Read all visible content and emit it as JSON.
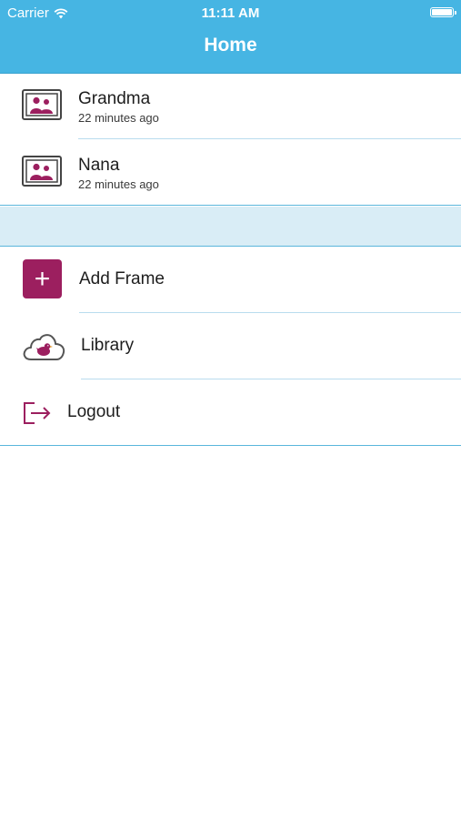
{
  "status_bar": {
    "carrier": "Carrier",
    "time": "11:11 AM",
    "wifi_icon": "wifi-icon",
    "battery_icon": "battery-icon"
  },
  "nav": {
    "title": "Home"
  },
  "frames": [
    {
      "name": "Grandma",
      "updated": "22 minutes ago",
      "icon": "photo-frame-icon"
    },
    {
      "name": "Nana",
      "updated": "22 minutes ago",
      "icon": "photo-frame-icon"
    }
  ],
  "menu": {
    "add_frame": {
      "label": "Add Frame",
      "icon": "plus-icon"
    },
    "library": {
      "label": "Library",
      "icon": "cloud-bird-icon"
    },
    "logout": {
      "label": "Logout",
      "icon": "logout-icon"
    }
  },
  "colors": {
    "header": "#46b5e3",
    "accent": "#9c1f5f",
    "separator": "#5ab6dc",
    "band": "#d9edf6"
  }
}
